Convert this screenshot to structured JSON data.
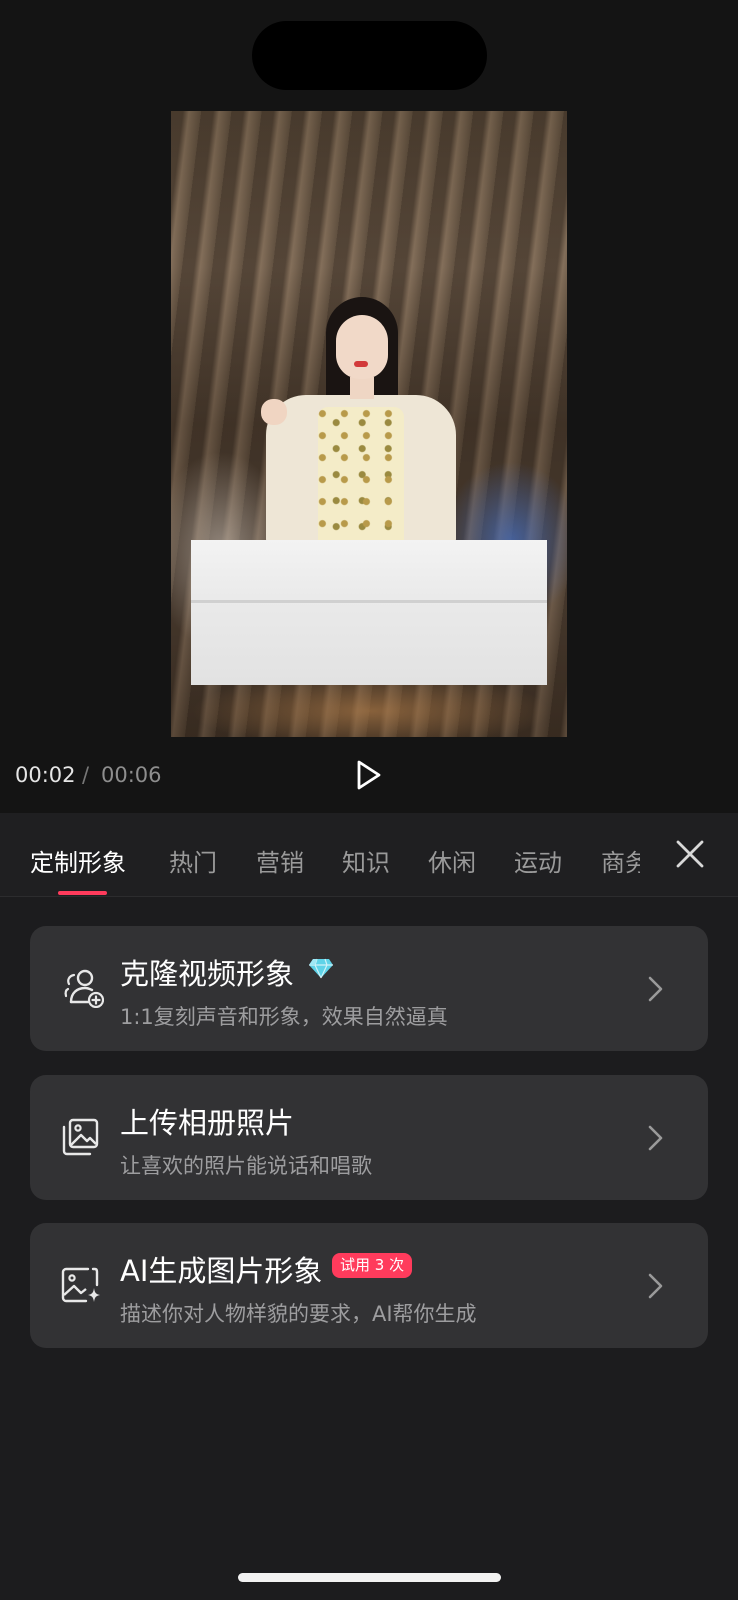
{
  "player": {
    "current_time": "00:02",
    "separator": "/",
    "total_time": "00:06"
  },
  "tabs": [
    {
      "label": "定制形象",
      "active": true
    },
    {
      "label": "热门"
    },
    {
      "label": "营销"
    },
    {
      "label": "知识"
    },
    {
      "label": "休闲"
    },
    {
      "label": "运动"
    },
    {
      "label": "商务"
    }
  ],
  "options": [
    {
      "title": "克隆视频形象",
      "subtitle": "1:1复刻声音和形象，效果自然逼真",
      "icon": "person-add-icon",
      "extra_icon": "diamond-icon"
    },
    {
      "title": "上传相册照片",
      "subtitle": "让喜欢的照片能说话和唱歌",
      "icon": "photo-album-icon"
    },
    {
      "title": "AI生成图片形象",
      "subtitle": "描述你对人物样貌的要求，AI帮你生成",
      "icon": "image-sparkle-icon",
      "badge": "试用 3 次"
    }
  ],
  "colors": {
    "accent": "#ff3b5c",
    "background": "#1c1c1e",
    "card": "#323234"
  }
}
